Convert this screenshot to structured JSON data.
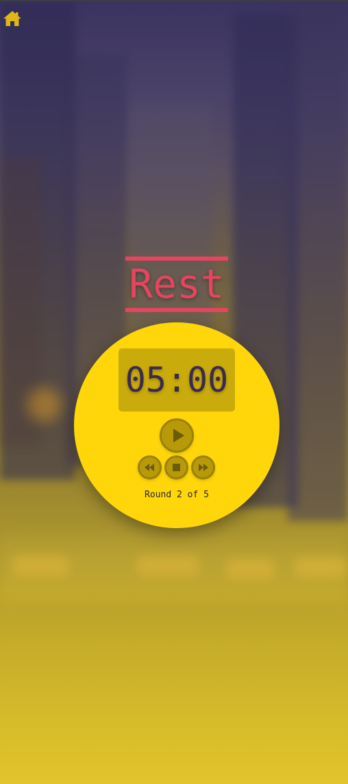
{
  "nav": {
    "home_icon": "home-icon",
    "home_color": "#e0b71a"
  },
  "phase": {
    "label": "Rest",
    "color": "#e5455f"
  },
  "timer": {
    "display": "05:00",
    "dial_color": "#ffd60a",
    "text_color": "#3b2a4f"
  },
  "controls": {
    "play_icon": "play-icon",
    "rewind_icon": "rewind-icon",
    "stop_icon": "stop-icon",
    "fast_forward_icon": "fast-forward-icon"
  },
  "round": {
    "text": "Round 2 of 5"
  }
}
